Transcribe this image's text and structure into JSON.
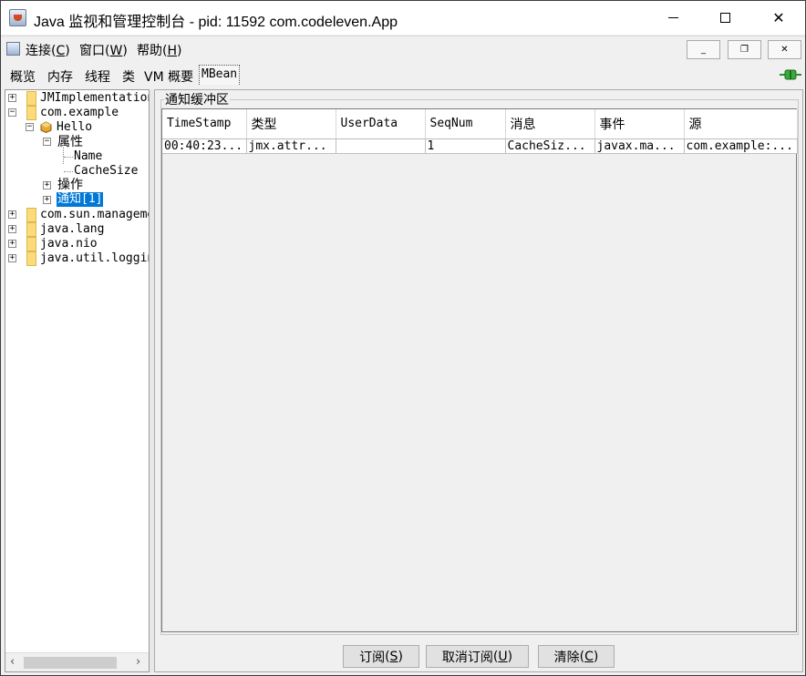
{
  "window": {
    "title": "Java 监视和管理控制台 - pid: 11592 com.codeleven.App",
    "minimize": "minimize",
    "maximize": "maximize",
    "close": "✕"
  },
  "menubar": {
    "items": [
      {
        "label": "连接",
        "mnemonic": "C"
      },
      {
        "label": "窗口",
        "mnemonic": "W"
      },
      {
        "label": "帮助",
        "mnemonic": "H"
      }
    ],
    "mdi": {
      "minimize": "_",
      "restore": "❐",
      "close": "✕"
    }
  },
  "tabs": [
    {
      "label": "概览"
    },
    {
      "label": "内存"
    },
    {
      "label": "线程"
    },
    {
      "label": "类"
    },
    {
      "label": "VM 概要"
    },
    {
      "label": "MBean",
      "active": true
    }
  ],
  "tree": {
    "nodes": [
      {
        "label": "JMImplementation",
        "expander": "+"
      },
      {
        "label": "com.example",
        "expander": "−"
      },
      {
        "label": "Hello",
        "expander": "−",
        "icon": "bean-icon"
      },
      {
        "label": "属性",
        "expander": "−"
      },
      {
        "label": "Name"
      },
      {
        "label": "CacheSize"
      },
      {
        "label": "操作",
        "expander": "+"
      },
      {
        "label": "通知[1]",
        "expander": "+",
        "selected": true
      },
      {
        "label": "com.sun.management",
        "expander": "+"
      },
      {
        "label": "java.lang",
        "expander": "+"
      },
      {
        "label": "java.nio",
        "expander": "+"
      },
      {
        "label": "java.util.logging",
        "expander": "+"
      }
    ]
  },
  "notifications": {
    "title": "通知缓冲区",
    "columns": [
      "TimeStamp",
      "类型",
      "UserData",
      "SeqNum",
      "消息",
      "事件",
      "源"
    ],
    "rows": [
      [
        "00:40:23...",
        "jmx.attr...",
        "",
        "1",
        "CacheSiz...",
        "javax.ma...",
        "com.example:..."
      ]
    ]
  },
  "buttons": {
    "subscribe": {
      "label": "订阅",
      "mnemonic": "S"
    },
    "unsubscribe": {
      "label": "取消订阅",
      "mnemonic": "U"
    },
    "clear": {
      "label": "清除",
      "mnemonic": "C"
    }
  }
}
